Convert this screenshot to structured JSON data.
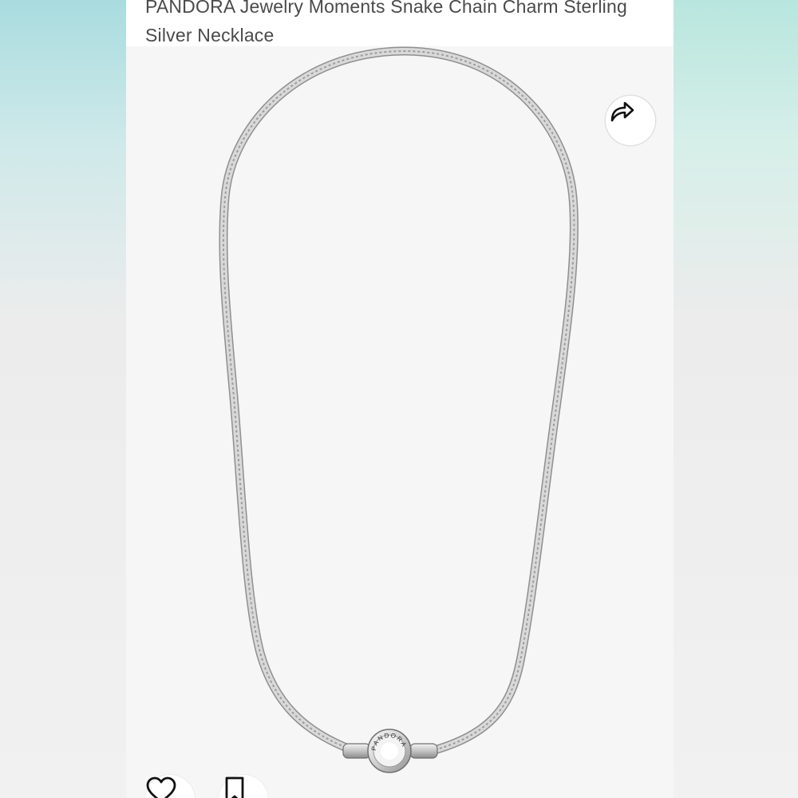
{
  "product": {
    "title_line1": "PANDORA Jewelry Moments Snake Chain Charm Sterling",
    "title_line2": "Silver Necklace"
  },
  "actions": {
    "share_icon": "share-arrow-icon",
    "favorite_icon": "heart-outline-icon",
    "save_icon": "bookmark-outline-icon"
  },
  "image": {
    "clasp_engraving": "PANDORA"
  },
  "colors": {
    "page_background": "#f6f6f6",
    "title_text": "#4a4a4a",
    "icon_stroke": "#111111",
    "chain_silver": "#b9b9b9"
  }
}
